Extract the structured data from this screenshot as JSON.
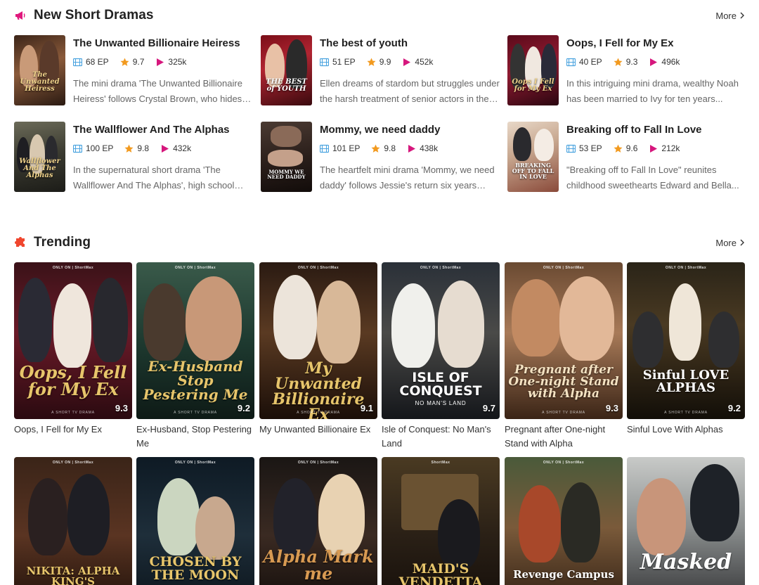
{
  "new_dramas": {
    "title": "New Short Dramas",
    "more": "More",
    "items": [
      {
        "title": "The Unwanted Billionaire Heiress",
        "episodes": "68 EP",
        "rating": "9.7",
        "views": "325k",
        "desc": "The mini drama 'The Unwanted Billionaire Heiress' follows Crystal Brown, who hides her true identity as a billionaire heiress...",
        "logo": "The Unwanted Heiress"
      },
      {
        "title": "The best of youth",
        "episodes": "51 EP",
        "rating": "9.9",
        "views": "452k",
        "desc": "Ellen dreams of stardom but struggles under the harsh treatment of senior actors in the crew...",
        "logo": "THE BEST of YOUTH"
      },
      {
        "title": "Oops, I Fell for My Ex",
        "episodes": "40 EP",
        "rating": "9.3",
        "views": "496k",
        "desc": "In this intriguing mini drama, wealthy Noah has been married to Ivy for ten years...",
        "logo": "Oops I Fell for My Ex"
      },
      {
        "title": "The Wallflower And The Alphas",
        "episodes": "100 EP",
        "rating": "9.8",
        "views": "432k",
        "desc": "In the supernatural short drama 'The Wallflower And The Alphas', high school student...",
        "logo": "Wallflower And The Alphas"
      },
      {
        "title": "Mommy, we need daddy",
        "episodes": "101 EP",
        "rating": "9.8",
        "views": "438k",
        "desc": "The heartfelt mini drama 'Mommy, we need daddy' follows Jessie's return six years later...",
        "logo": "MOMMY WE NEED DADDY"
      },
      {
        "title": "Breaking off to Fall In Love",
        "episodes": "53 EP",
        "rating": "9.6",
        "views": "212k",
        "desc": "\"Breaking off to Fall In Love\" reunites childhood sweethearts Edward and Bella...",
        "logo": "BREAKING OFF TO FALL IN LOVE"
      }
    ]
  },
  "trending": {
    "title": "Trending",
    "more": "More",
    "items": [
      {
        "title": "Oops, I Fell for My Ex",
        "score": "9.3",
        "logo": "Oops, I Fell for My Ex",
        "brand": "ONLY ON | ShortMax",
        "tag": "A SHORT TV DRAMA"
      },
      {
        "title": "Ex-Husband, Stop Pestering Me",
        "score": "9.2",
        "logo": "Ex-Husband Stop Pestering Me",
        "brand": "ONLY ON | ShortMax",
        "tag": "A SHORT TV DRAMA"
      },
      {
        "title": "My Unwanted Billionaire Ex",
        "score": "9.1",
        "logo": "My Unwanted Billionaire Ex",
        "brand": "ONLY ON | ShortMax",
        "tag": "A SHORT TV DRAMA"
      },
      {
        "title": "Isle of Conquest: No Man's Land",
        "score": "9.7",
        "logo": "ISLE OF CONQUEST",
        "brand": "ONLY ON | ShortMax",
        "tag": "NO MAN'S LAND"
      },
      {
        "title": "Pregnant after One-night Stand with Alpha",
        "score": "9.3",
        "logo": "Pregnant after One-night Stand with Alpha",
        "brand": "ONLY ON | ShortMax",
        "tag": "A SHORT TV DRAMA"
      },
      {
        "title": "Sinful Love With Alphas",
        "score": "9.2",
        "logo": "Sinful LOVE ALPHAS",
        "brand": "ONLY ON | ShortMax",
        "tag": "A SHORT TV DRAMA"
      },
      {
        "title": "",
        "score": "",
        "logo": "NIKITA: ALPHA KING'S",
        "brand": "ONLY ON | ShortMax",
        "tag": ""
      },
      {
        "title": "",
        "score": "",
        "logo": "CHOSEN BY THE MOON",
        "brand": "ONLY ON | ShortMax",
        "tag": ""
      },
      {
        "title": "",
        "score": "",
        "logo": "Alpha Mark me",
        "brand": "ONLY ON | ShortMax",
        "tag": ""
      },
      {
        "title": "",
        "score": "",
        "logo": "MAID'S VENDETTA",
        "brand": "ShortMax",
        "tag": ""
      },
      {
        "title": "",
        "score": "",
        "logo": "Revenge Campus",
        "brand": "ONLY ON | ShortMax",
        "tag": ""
      },
      {
        "title": "",
        "score": "",
        "logo": "Masked",
        "brand": "",
        "tag": ""
      }
    ]
  },
  "colors": {
    "accent": "#e0187d",
    "star": "#f29a1f",
    "film": "#4aa3df",
    "play": "#d6177d",
    "logo_gold": "#e7c56b"
  }
}
